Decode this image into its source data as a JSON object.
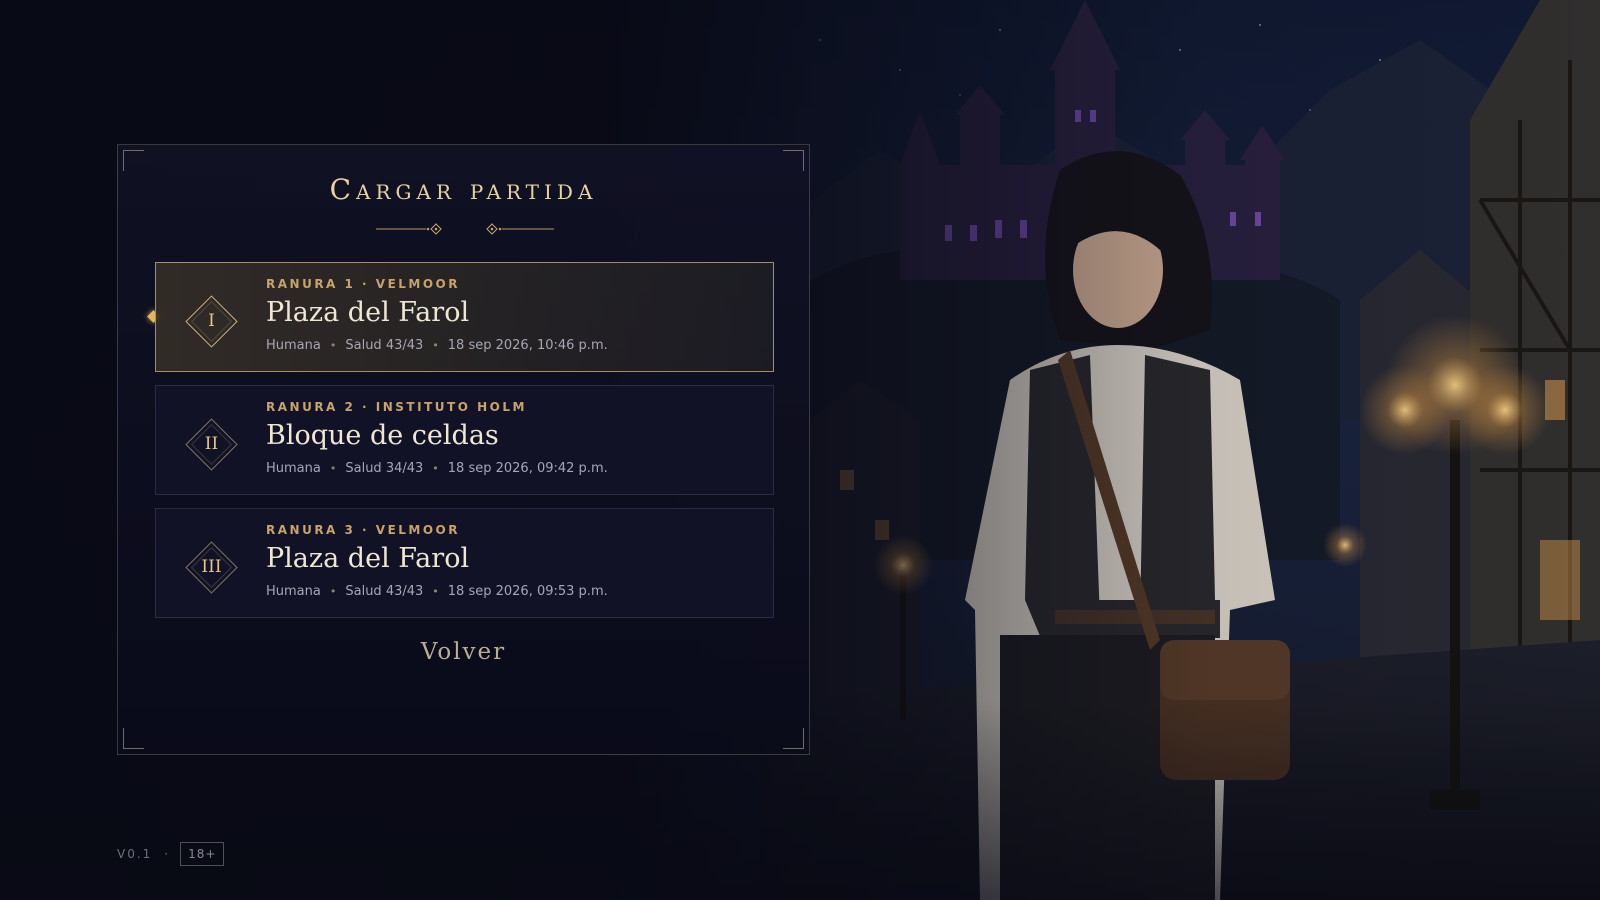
{
  "menu": {
    "title": "Cargar partida",
    "slots": [
      {
        "numeral": "I",
        "label": "Ranura 1 · Velmoor",
        "title": "Plaza del Farol",
        "race": "Humana",
        "health": "Salud 43/43",
        "date": "18 sep 2026, 10:46 p.m.",
        "selected": true
      },
      {
        "numeral": "II",
        "label": "Ranura 2 · Instituto Holm",
        "title": "Bloque de celdas",
        "race": "Humana",
        "health": "Salud 34/43",
        "date": "18 sep 2026, 09:42 p.m.",
        "selected": false
      },
      {
        "numeral": "III",
        "label": "Ranura 3 · Velmoor",
        "title": "Plaza del Farol",
        "race": "Humana",
        "health": "Salud 43/43",
        "date": "18 sep 2026, 09:53 p.m.",
        "selected": false
      }
    ],
    "back_label": "Volver"
  },
  "footer": {
    "version": "V0.1",
    "separator": "·",
    "age_rating": "18+"
  },
  "colors": {
    "accent_gold": "#e7d2a2",
    "slot_label": "#c8a36a",
    "selected_border": "#d4b26e",
    "background": "#0b0c18"
  }
}
